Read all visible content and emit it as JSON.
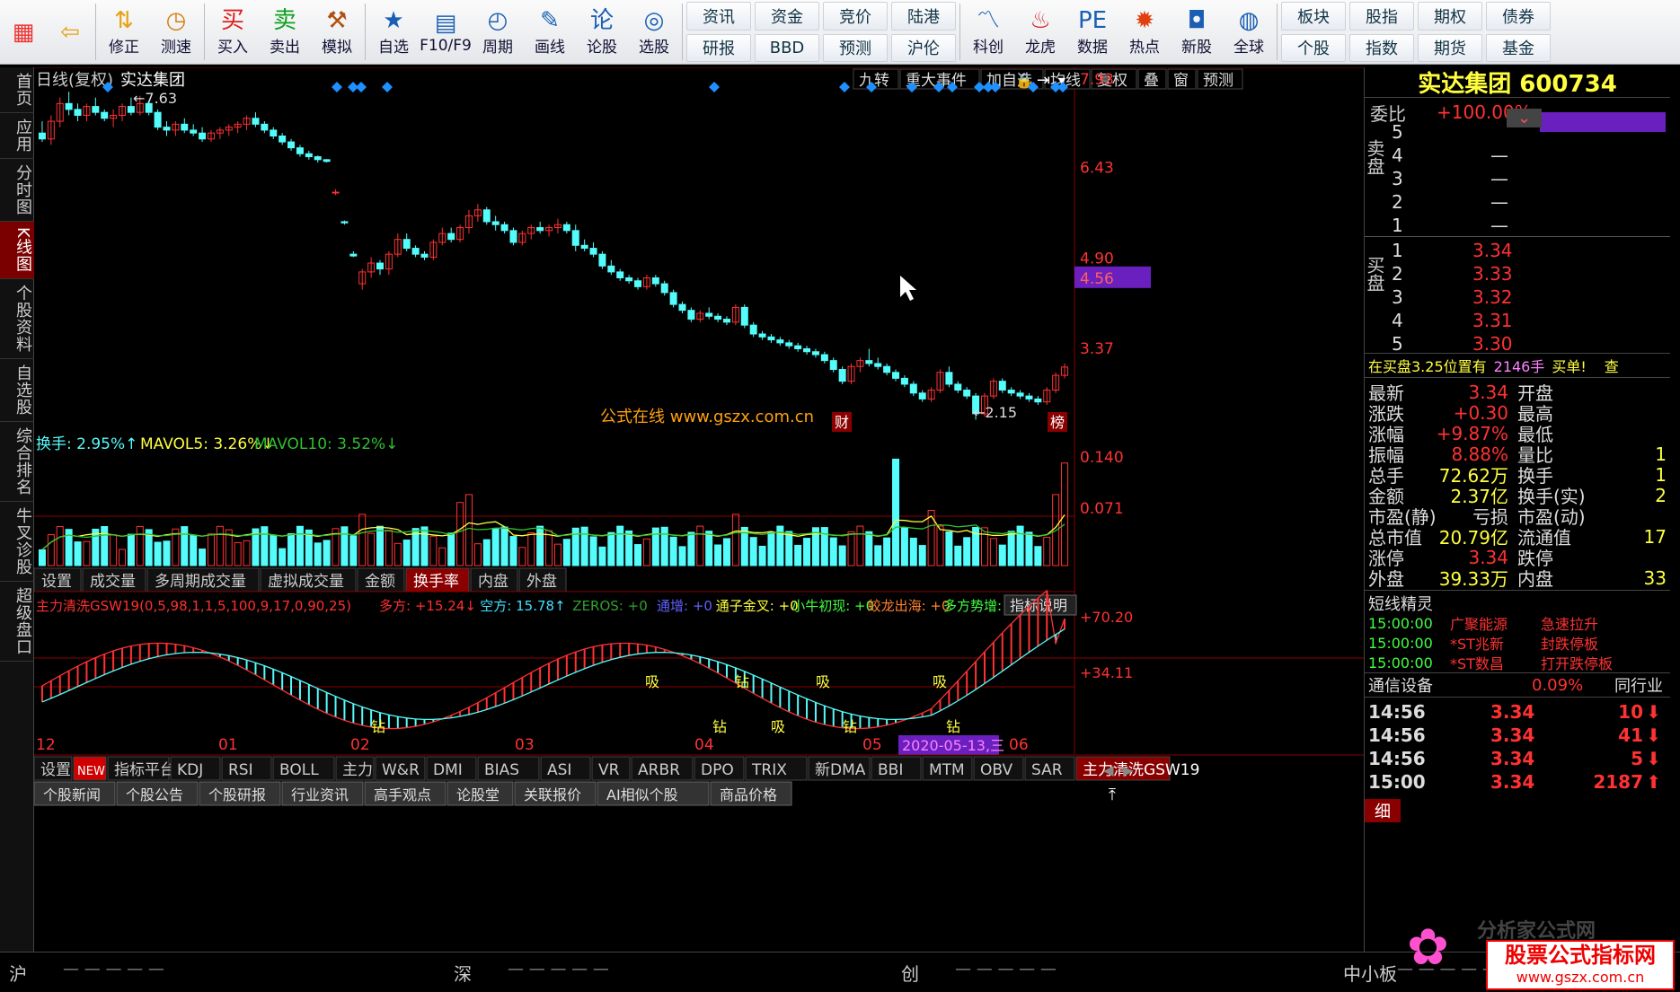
{
  "toolbar": {
    "buttons": [
      {
        "label": "",
        "icon": "tiles-icon"
      },
      {
        "label": "",
        "icon": "back-arrow-icon"
      },
      {
        "label": "修正",
        "icon": "up-down-arrow-icon"
      },
      {
        "label": "测速",
        "icon": "speed-clock-icon"
      },
      {
        "label": "买入",
        "icon": "buy-icon",
        "glyph": "买"
      },
      {
        "label": "卖出",
        "icon": "sell-icon",
        "glyph": "卖"
      },
      {
        "label": "模拟",
        "icon": "hammer-icon"
      },
      {
        "label": "自选",
        "icon": "star-icon"
      },
      {
        "label": "F10/F9",
        "icon": "f10-icon"
      },
      {
        "label": "周期",
        "icon": "cycle-icon"
      },
      {
        "label": "画线",
        "icon": "pen-icon"
      },
      {
        "label": "论股",
        "icon": "discuss-icon"
      },
      {
        "label": "选股",
        "icon": "select-icon"
      }
    ],
    "grid1": [
      "资讯",
      "研报",
      "资金",
      "BBD",
      "竞价",
      "预测",
      "陆港",
      "沪伦"
    ],
    "buttons2": [
      {
        "label": "科创",
        "icon": "kechuang-icon"
      },
      {
        "label": "龙虎",
        "icon": "dragon-icon"
      },
      {
        "label": "数据",
        "icon": "pe-icon"
      },
      {
        "label": "热点",
        "icon": "hot-icon"
      },
      {
        "label": "新股",
        "icon": "ipo-icon"
      },
      {
        "label": "全球",
        "icon": "globe-icon"
      }
    ],
    "grid2": [
      "板块",
      "个股",
      "股指",
      "指数",
      "期权",
      "期货",
      "债券",
      "基金"
    ]
  },
  "leftnav": [
    "首页",
    "应用",
    "分时图",
    "K线图",
    "个股资料",
    "自选股",
    "综合排名",
    "牛叉诊股",
    "超级盘口"
  ],
  "chart": {
    "header_left": "日线(复权)",
    "stock_name": "实达集团",
    "top_tabs": [
      "九转",
      "重大事件",
      "加自选",
      "均线",
      "复权",
      "叠",
      "窗",
      "预测"
    ],
    "price_labels": [
      "7.93",
      "6.43",
      "4.90",
      "4.56",
      "3.37"
    ],
    "max_label": "7.63",
    "min_label": "2.15",
    "watermark": "公式在线  www.gszx.com.cn",
    "tag_cai": "财",
    "tag_bang": "榜",
    "vol_header": {
      "a": "换手: 2.95%↑",
      "b": "MAVOL5: 3.26%↓",
      "c": "MAVOL10: 3.52%↓"
    },
    "vol_labels": [
      "0.140",
      "0.071"
    ],
    "vol_tabs": [
      "设置",
      "成交量",
      "多周期成交量",
      "虚拟成交量",
      "金额",
      "换手率",
      "内盘",
      "外盘"
    ],
    "ind_header": [
      {
        "t": "主力清洗GSW19(0,5,98,1,1,5,100,9,17,0,90,25)",
        "c": "#ff3030"
      },
      {
        "t": "多方: +15.24↓",
        "c": "#ff3030"
      },
      {
        "t": "空方: 15.78↑",
        "c": "#40e0ff"
      },
      {
        "t": "ZEROS: +0",
        "c": "#30a030"
      },
      {
        "t": "通增: +0",
        "c": "#6060ff"
      },
      {
        "t": "通子金叉: +0",
        "c": "#ffff40"
      },
      {
        "t": "小牛初现: +0",
        "c": "#40ff40"
      },
      {
        "t": "蛟龙出海: +0",
        "c": "#ff8030"
      },
      {
        "t": "多方势增: +0",
        "c": "#40ff40"
      },
      {
        "t": "钻",
        "c": "#ffff40"
      }
    ],
    "ind_btn": "指标说明",
    "ind_labels": [
      "+70.20",
      "+34.11"
    ],
    "ind_tags": [
      "钻",
      "吸",
      "钻",
      "钻",
      "吸",
      "吸",
      "钻",
      "吸",
      "钻"
    ],
    "months": [
      "12",
      "01",
      "02",
      "03",
      "04",
      "05",
      "06"
    ],
    "date_highlight": "2020-05-13,三",
    "ind_tabs": [
      "设置",
      "NEW",
      "指标平台",
      "KDJ",
      "RSI",
      "BOLL",
      "主力",
      "W&R",
      "DMI",
      "BIAS",
      "ASI",
      "VR",
      "ARBR",
      "DPO",
      "TRIX",
      "新DMA",
      "BBI",
      "MTM",
      "OBV",
      "SAR",
      "主力清洗GSW19"
    ],
    "news_tabs": [
      "个股新闻",
      "个股公告",
      "个股研报",
      "行业资讯",
      "高手观点",
      "论股堂",
      "关联报价",
      "AI相似个股",
      "商品价格"
    ]
  },
  "right": {
    "title": "实达集团 600734",
    "weibi_label": "委比",
    "weibi_value": "+100.00%",
    "sell_label": "卖盘",
    "buy_label": "买盘",
    "sell": [
      {
        "n": "5",
        "p": "",
        "v": ""
      },
      {
        "n": "4",
        "p": "—",
        "v": ""
      },
      {
        "n": "3",
        "p": "—",
        "v": ""
      },
      {
        "n": "2",
        "p": "—",
        "v": ""
      },
      {
        "n": "1",
        "p": "—",
        "v": ""
      }
    ],
    "buy": [
      {
        "n": "1",
        "p": "3.34"
      },
      {
        "n": "2",
        "p": "3.33"
      },
      {
        "n": "3",
        "p": "3.32"
      },
      {
        "n": "4",
        "p": "3.31"
      },
      {
        "n": "5",
        "p": "3.30"
      }
    ],
    "buy_notice": "在买盘3.25位置有",
    "buy_notice_qty": "2146手",
    "buy_notice_tail": "买单!",
    "buy_notice_link": "查",
    "stats": [
      {
        "k": "最新",
        "v": "3.34",
        "k2": "开盘",
        "v2": ""
      },
      {
        "k": "涨跌",
        "v": "+0.30",
        "k2": "最高",
        "v2": ""
      },
      {
        "k": "涨幅",
        "v": "+9.87%",
        "k2": "最低",
        "v2": ""
      },
      {
        "k": "振幅",
        "v": "8.88%",
        "k2": "量比",
        "v2": "1"
      },
      {
        "k": "总手",
        "v": "72.62万",
        "k2": "换手",
        "v2": "1"
      },
      {
        "k": "金额",
        "v": "2.37亿",
        "k2": "换手(实)",
        "v2": "2"
      },
      {
        "k": "市盈(静)",
        "v": "亏损",
        "k2": "市盈(动)",
        "v2": ""
      },
      {
        "k": "总市值",
        "v": "20.79亿",
        "k2": "流通值",
        "v2": "17"
      },
      {
        "k": "涨停",
        "v": "3.34",
        "k2": "跌停",
        "v2": ""
      },
      {
        "k": "外盘",
        "v": "39.33万",
        "k2": "内盘",
        "v2": "33"
      }
    ],
    "sprite_title": "短线精灵",
    "sprite": [
      {
        "time": "15:00:00",
        "name": "广聚能源",
        "ev": "急速拉升"
      },
      {
        "time": "15:00:00",
        "name": "*ST兆新",
        "ev": "封跌停板"
      },
      {
        "time": "15:00:00",
        "name": "*ST数昌",
        "ev": "打开跌停板"
      }
    ],
    "industry": {
      "name": "通信设备",
      "pct": "0.09%",
      "tail": "同行业"
    },
    "ticks": [
      {
        "t": "14:56",
        "p": "3.34",
        "v": "10"
      },
      {
        "t": "14:56",
        "p": "3.34",
        "v": "41"
      },
      {
        "t": "14:56",
        "p": "3.34",
        "v": "5"
      },
      {
        "t": "15:00",
        "p": "3.34",
        "v": "2187"
      }
    ],
    "detail_tab": "细"
  },
  "bottom": {
    "markets": [
      "沪",
      "深",
      "创",
      "中小板"
    ],
    "logo_text": "股票公式指标网",
    "logo_url": "www.gszx.com.cn",
    "logo_brand": "分析家公式网"
  },
  "colors": {
    "up": "#ff3232",
    "down": "#54fcfc",
    "yellow": "#ffff40",
    "green": "#30c030",
    "purple": "#6a1fbf",
    "accent": "#ffd040"
  }
}
